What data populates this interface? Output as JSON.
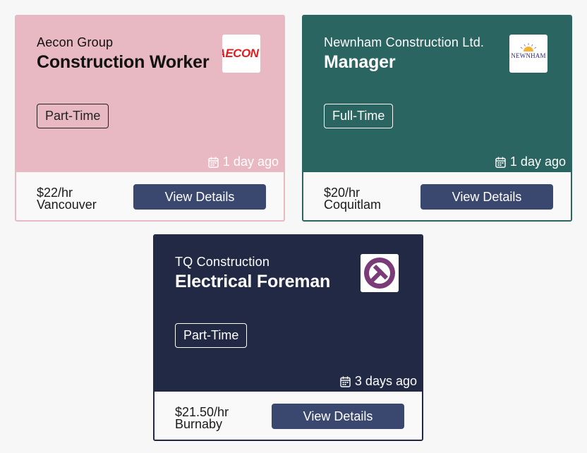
{
  "colors": {
    "card_pink": "#e8b8c3",
    "card_teal": "#2b6561",
    "card_navy": "#222944",
    "button": "#3a4870",
    "background": "#f7f7f8"
  },
  "jobs": [
    {
      "company": "Aecon Group",
      "title": "Construction Worker",
      "job_type": "Part-Time",
      "posted": "1 day ago",
      "salary": "$22/hr",
      "location": "Vancouver",
      "button_label": "View Details",
      "logo_text": "AECON",
      "logo_icon": "aecon-logo"
    },
    {
      "company": "Newnham Construction Ltd.",
      "title": "Manager",
      "job_type": "Full-Time",
      "posted": "1 day ago",
      "salary": "$20/hr",
      "location": "Coquitlam",
      "button_label": "View Details",
      "logo_text": "NEWNHAM",
      "logo_icon": "newnham-logo"
    },
    {
      "company": "TQ Construction",
      "title": "Electrical Foreman",
      "job_type": "Part-Time",
      "posted": "3 days ago",
      "salary": "$21.50/hr",
      "location": "Burnaby",
      "button_label": "View Details",
      "logo_text": "",
      "logo_icon": "tq-logo"
    }
  ],
  "icons": {
    "posted": "calendar-icon"
  }
}
